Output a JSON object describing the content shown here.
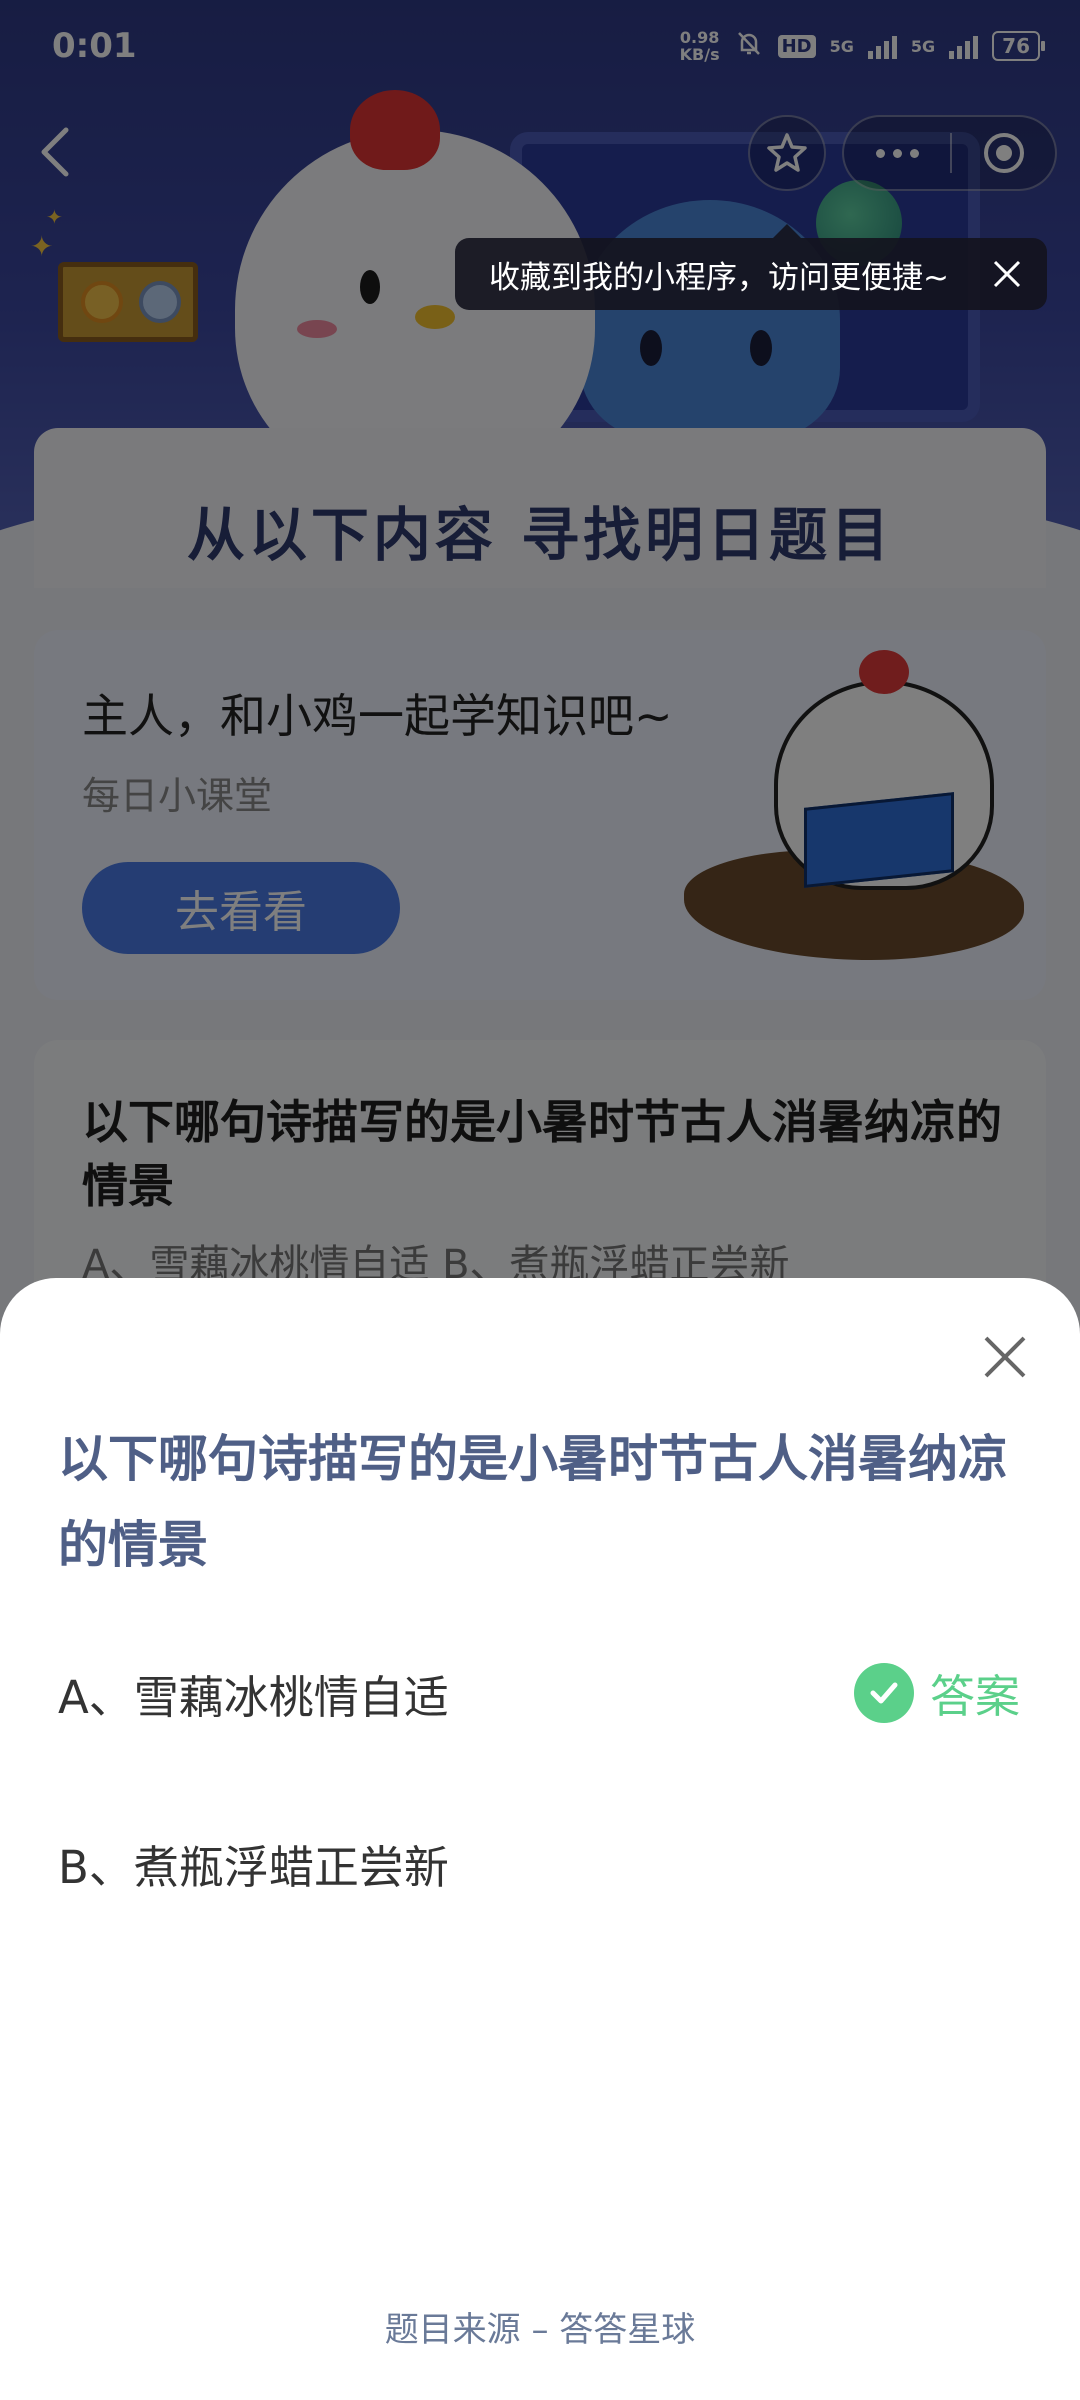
{
  "status_bar": {
    "time": "0:01",
    "speed_value": "0.98",
    "speed_unit": "KB/s",
    "hd_label": "HD",
    "sig1": "5G",
    "sig2": "5G",
    "battery": "76"
  },
  "tooltip": {
    "text": "收藏到我的小程序，访问更便捷~"
  },
  "find_section": {
    "title": "从以下内容  寻找明日题目"
  },
  "course_card": {
    "title": "主人，和小鸡一起学知识吧~",
    "subtitle": "每日小课堂",
    "button_label": "去看看"
  },
  "question_card": {
    "title": "以下哪句诗描写的是小暑时节古人消暑纳凉的情景",
    "options_preview": "A、雪藕冰桃情自适    B、煮瓶浮蜡正尝新"
  },
  "sheet": {
    "question": "以下哪句诗描写的是小暑时节古人消暑纳凉的情景",
    "options": [
      {
        "label": "A、雪藕冰桃情自适",
        "is_answer": true
      },
      {
        "label": "B、煮瓶浮蜡正尝新",
        "is_answer": false
      }
    ],
    "answer_label": "答案",
    "source": "题目来源 – 答答星球"
  },
  "colors": {
    "accent_question": "#4f5f86",
    "answer_green": "#5bd08a",
    "hero_blue": "#2f3a86"
  },
  "icons": [
    "back-arrow-icon",
    "star-icon",
    "more-dots-icon",
    "target-icon",
    "close-icon",
    "check-icon",
    "mute-bell-icon"
  ]
}
